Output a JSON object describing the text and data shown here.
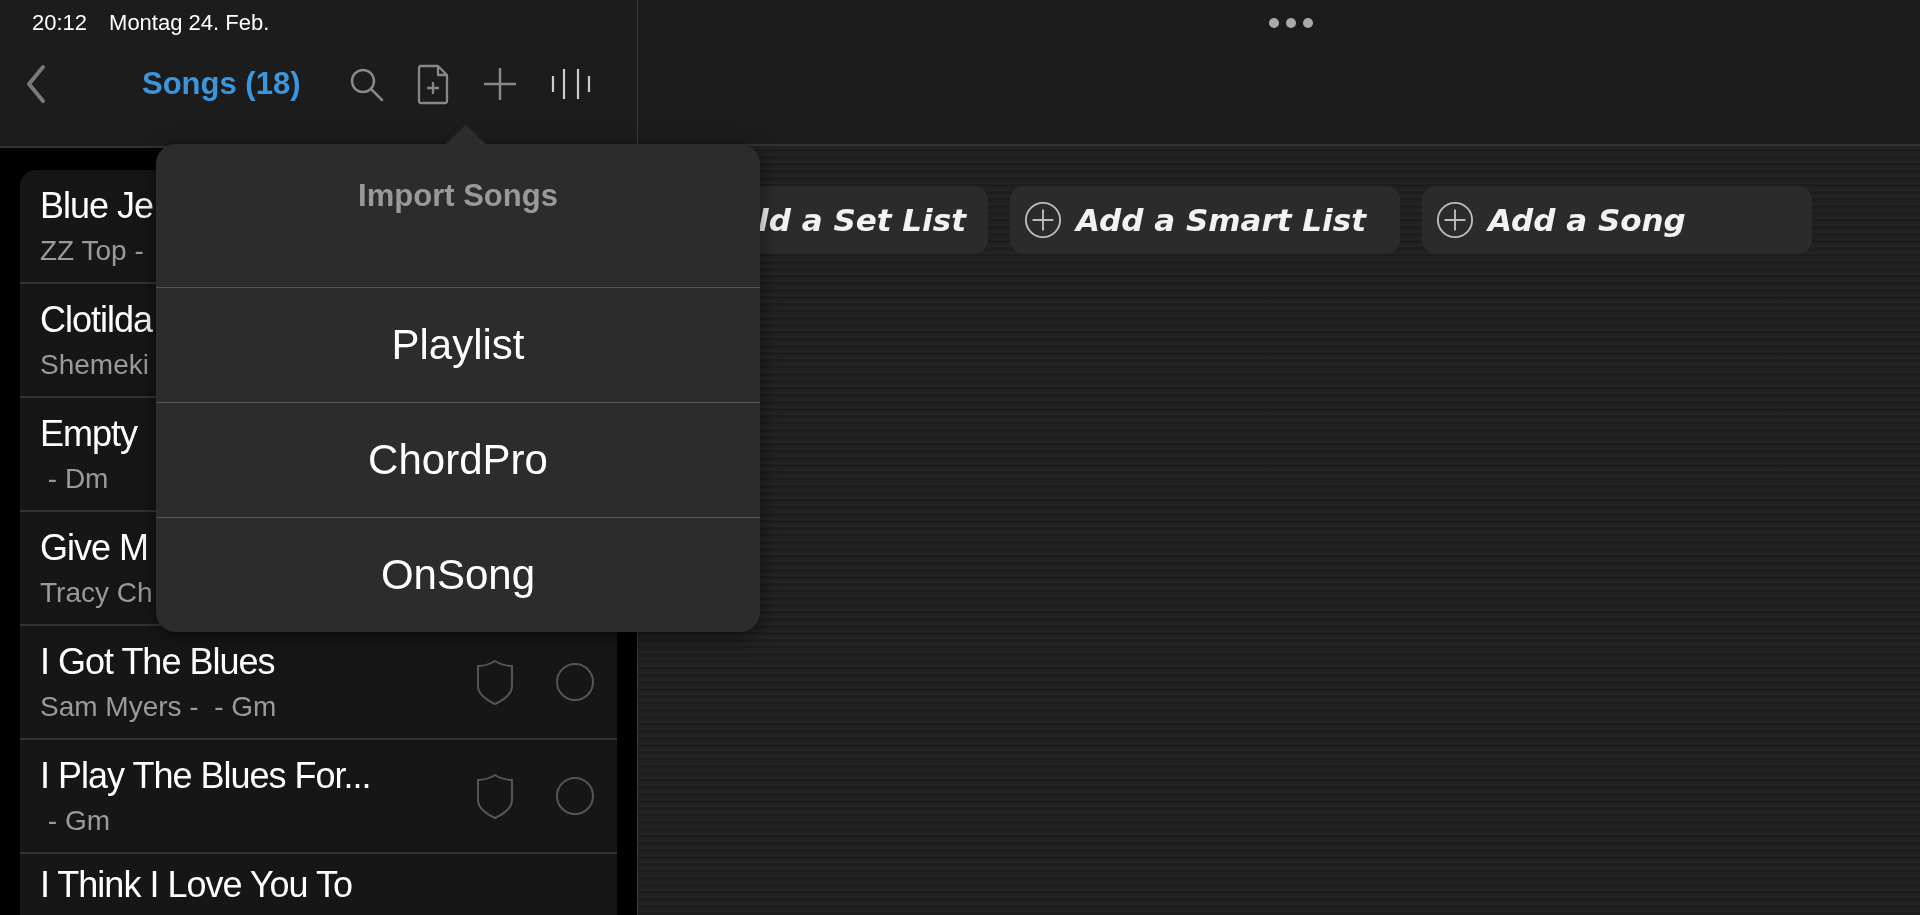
{
  "status_bar": {
    "time": "20:12",
    "date": "Montag 24. Feb."
  },
  "nav": {
    "title": "Songs (18)"
  },
  "songs": [
    {
      "kind": "covered",
      "title": "Blue Je",
      "subtitle": "ZZ Top -"
    },
    {
      "kind": "covered",
      "title": "Clotilda",
      "subtitle": "Shemeki"
    },
    {
      "kind": "covered",
      "title": "Empty",
      "subtitle": " - Dm"
    },
    {
      "kind": "covered",
      "title": "Give M",
      "subtitle": "Tracy Ch"
    },
    {
      "kind": "full",
      "title": "I Got The Blues",
      "subtitle": "Sam Myers -  - Gm"
    },
    {
      "kind": "full",
      "title": "I Play The Blues For...",
      "subtitle": " - Gm"
    },
    {
      "kind": "cut",
      "title": "I Think I Love You To"
    }
  ],
  "actions": [
    "ld a Set List",
    "Add a Smart List",
    "Add a Song"
  ],
  "popover": {
    "title": "Import Songs",
    "items": [
      "Playlist",
      "ChordPro",
      "OnSong"
    ]
  }
}
